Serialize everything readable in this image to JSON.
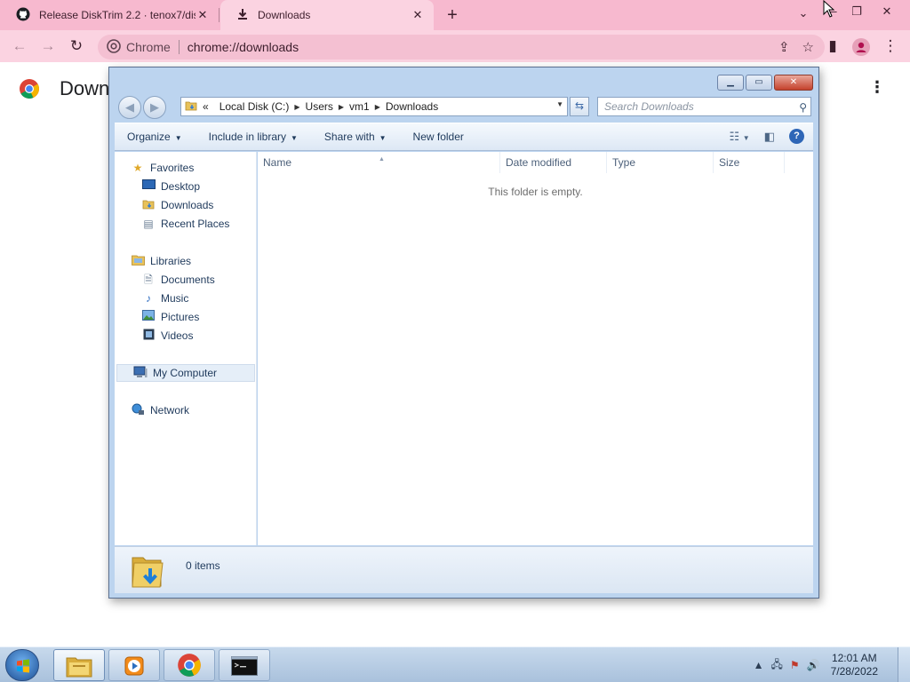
{
  "browser": {
    "tabs": [
      {
        "label": "Release DiskTrim 2.2 · tenox7/dis",
        "icon": "github-icon",
        "active": false
      },
      {
        "label": "Downloads",
        "icon": "download-icon",
        "active": true
      }
    ],
    "omnibox": {
      "site_label": "Chrome",
      "url": "chrome://downloads"
    },
    "page_title": "Down"
  },
  "explorer": {
    "address": {
      "overflow": "«",
      "crumbs": [
        "Local Disk (C:)",
        "Users",
        "vm1",
        "Downloads"
      ]
    },
    "search_placeholder": "Search Downloads",
    "commands": [
      {
        "label": "Organize",
        "dropdown": true
      },
      {
        "label": "Include in library",
        "dropdown": true
      },
      {
        "label": "Share with",
        "dropdown": true
      },
      {
        "label": "New folder",
        "dropdown": false
      }
    ],
    "nav": {
      "favorites": {
        "label": "Favorites",
        "items": [
          "Desktop",
          "Downloads",
          "Recent Places"
        ]
      },
      "libraries": {
        "label": "Libraries",
        "items": [
          "Documents",
          "Music",
          "Pictures",
          "Videos"
        ]
      },
      "computer": "My Computer",
      "network": "Network"
    },
    "columns": [
      "Name",
      "Date modified",
      "Type",
      "Size"
    ],
    "empty_message": "This folder is empty.",
    "status": "0 items"
  },
  "taskbar": {
    "clock_time": "12:01 AM",
    "clock_date": "7/28/2022",
    "buttons": [
      "explorer-icon",
      "media-player-icon",
      "chrome-icon",
      "cmd-icon"
    ]
  },
  "colors": {
    "chrome_tabstrip": "#f7b9cf",
    "chrome_toolbar": "#fbd3e1",
    "explorer_frame": "#bcd4ef",
    "taskbar": "#b9cde4"
  }
}
